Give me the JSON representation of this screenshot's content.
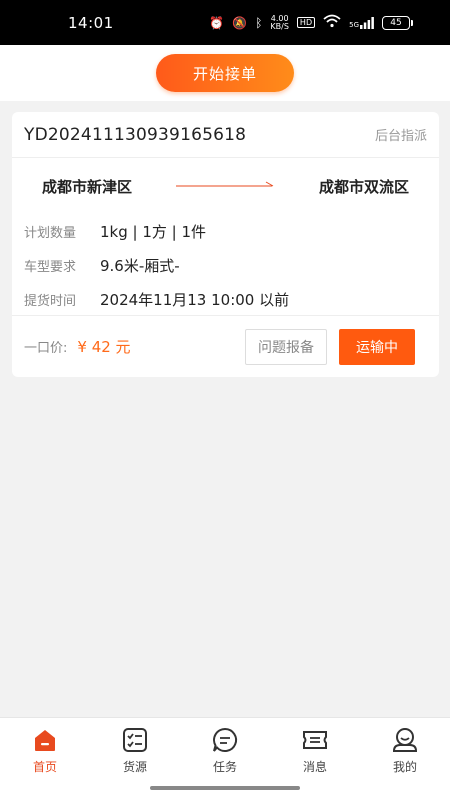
{
  "status_bar": {
    "time": "14:01",
    "net_speed_value": "4.00",
    "net_speed_unit": "KB/S",
    "hd": "HD",
    "signal": "5G",
    "battery": "45"
  },
  "header": {
    "start_button": "开始接单"
  },
  "order": {
    "order_no": "YD20241113093916561​8",
    "assign_type": "后台指派",
    "from_city": "成都市新津区",
    "to_city": "成都市双流区",
    "fields": [
      {
        "label": "计划数量",
        "value": "1kg | 1方 | 1件"
      },
      {
        "label": "车型要求",
        "value": "9.6米-厢式-"
      },
      {
        "label": "提货时间",
        "value": "2024年11月13 10:00 以前"
      }
    ],
    "price_label": "一口价:",
    "price": "¥ 42 元",
    "report_button": "问题报备",
    "status_button": "运输中"
  },
  "tabbar": {
    "items": [
      {
        "label": "首页",
        "icon": "home-icon",
        "active": true
      },
      {
        "label": "货源",
        "icon": "checklist-icon",
        "active": false
      },
      {
        "label": "任务",
        "icon": "chat-bubble-icon",
        "active": false
      },
      {
        "label": "消息",
        "icon": "ticket-icon",
        "active": false
      },
      {
        "label": "我的",
        "icon": "user-icon",
        "active": false
      }
    ]
  },
  "colors": {
    "accent": "#ff5a0f",
    "tab_active": "#e84a1f"
  }
}
